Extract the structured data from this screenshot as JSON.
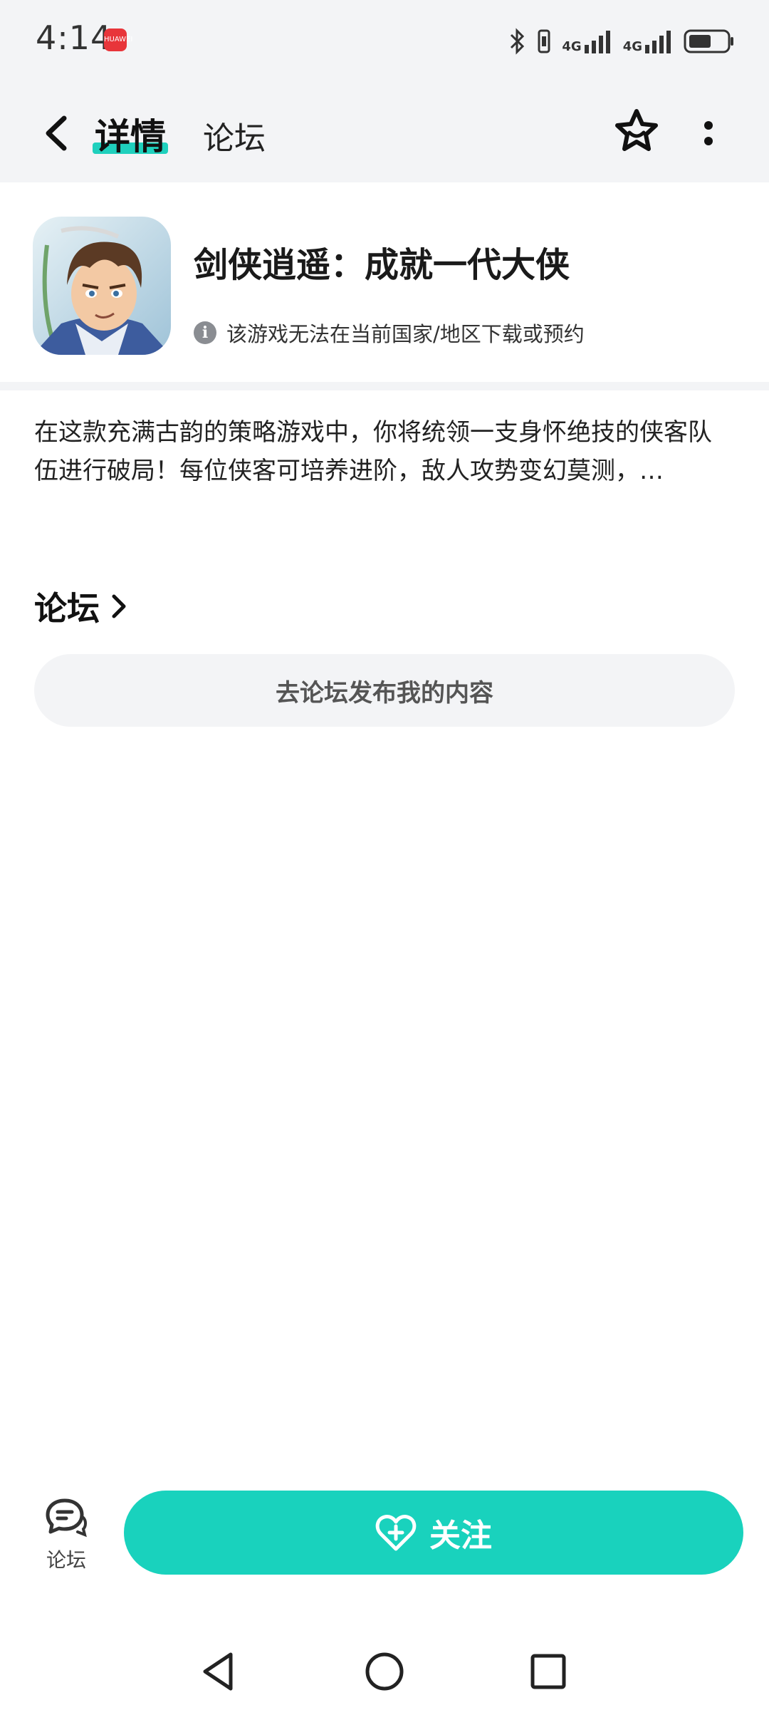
{
  "status_bar": {
    "time": "4:14",
    "app_badge": "HUAWEI",
    "network_1": "4G",
    "network_2": "4G"
  },
  "nav": {
    "tab_detail": "详情",
    "tab_forum": "论坛",
    "accent_color": "#1fd0bd"
  },
  "app": {
    "title": "剑侠逍遥：成就一代大侠",
    "notice": "该游戏无法在当前国家/地区下载或预约"
  },
  "description": "在这款充满古韵的策略游戏中，你将统领一支身怀绝技的侠客队伍进行破局！每位侠客可培养进阶，敌人攻势变幻莫测，…",
  "forum": {
    "heading": "论坛",
    "post_button": "去论坛发布我的内容"
  },
  "bottom_bar": {
    "forum_label": "论坛",
    "follow_label": "关注",
    "follow_color": "#19d2bd"
  },
  "icons": [
    "back-icon",
    "star-icon",
    "more-icon",
    "info-icon",
    "chevron-right-icon",
    "forum-chat-icon",
    "heart-plus-icon",
    "nav-back-icon",
    "nav-home-icon",
    "nav-recents-icon"
  ]
}
